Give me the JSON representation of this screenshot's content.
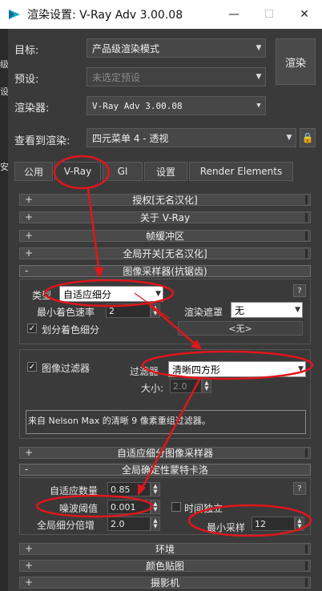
{
  "window": {
    "title": "渲染设置: V-Ray Adv 3.00.08",
    "minimize": "—",
    "maximize": "☐",
    "close": "✕"
  },
  "left_strip": [
    "级",
    "设",
    "安"
  ],
  "header": {
    "target_label": "目标:",
    "target_value": "产品级渲染模式",
    "preset_label": "预设:",
    "preset_value": "未选定预设",
    "renderer_label": "渲染器:",
    "renderer_value": "V-Ray Adv 3.00.08",
    "view_label": "查看到渲染:",
    "view_value": "四元菜单 4 - 透视",
    "render_button": "渲染"
  },
  "tabs": [
    {
      "label": "公用"
    },
    {
      "label": "V-Ray"
    },
    {
      "label": "GI"
    },
    {
      "label": "设置"
    },
    {
      "label": "Render Elements"
    }
  ],
  "rollouts": {
    "license": "授权[无名汉化]",
    "about": "关于 V-Ray",
    "framebuffer": "帧缓冲区",
    "global_switches": "全局开关[无名汉化]",
    "image_sampler": "图像采样器(抗锯齿)",
    "adaptive_subdiv": "自适应细分图像采样器",
    "global_dmc": "全局确定性蒙特卡洛",
    "environment": "环境",
    "color_mapping": "颜色贴图",
    "camera": "摄影机"
  },
  "image_sampler": {
    "type_label": "类型",
    "type_value": "自适应细分",
    "min_shading_label": "最小着色速率",
    "min_shading_value": "2",
    "render_mask_label": "渲染遮罩",
    "render_mask_value": "无",
    "none_button": "<无>",
    "divide_shading_label": "划分着色细分",
    "help": "?"
  },
  "image_filter": {
    "enabled_label": "图像过滤器",
    "filter_label": "过滤器",
    "filter_value": "清晰四方形",
    "size_label": "大小:",
    "size_value": "2.0",
    "description": "来自 Nelson Max 的清晰 9 像素重组过滤器。"
  },
  "dmc": {
    "adaptive_amount_label": "自适应数量",
    "adaptive_amount_value": "0.85",
    "noise_threshold_label": "噪波阈值",
    "noise_threshold_value": "0.001",
    "time_independent_label": "时间独立",
    "global_subdiv_label": "全局细分倍增",
    "global_subdiv_value": "2.0",
    "min_samples_label": "最小采样",
    "min_samples_value": "12",
    "help": "?"
  },
  "colors": {
    "annotation_red": "#e0161c",
    "lock_yellow": "#f2b93b",
    "app_icon": "#19a7c9"
  }
}
